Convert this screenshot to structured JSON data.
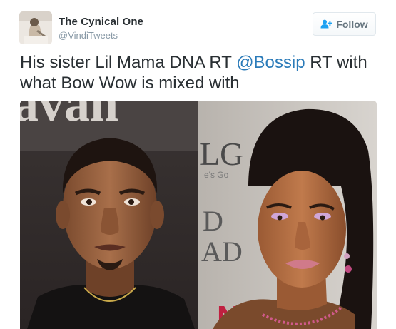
{
  "author": {
    "name": "The Cynical One",
    "handle": "@VindiTweets"
  },
  "follow_button": {
    "label": "Follow",
    "icon": "add-user-icon"
  },
  "tweet": {
    "text_before": "His sister Lil Mama DNA RT ",
    "mention": "@Bossip",
    "text_after": " RT with what Bow Wow is mixed with"
  },
  "photo": {
    "left_backdrop_text": "avan",
    "right_backdrop_letters": [
      "LG",
      "e's Go",
      "D",
      "AD",
      "NK"
    ]
  },
  "colors": {
    "link": "#2b7bb9",
    "secondary_text": "#8899a6",
    "primary_text": "#292f33"
  }
}
